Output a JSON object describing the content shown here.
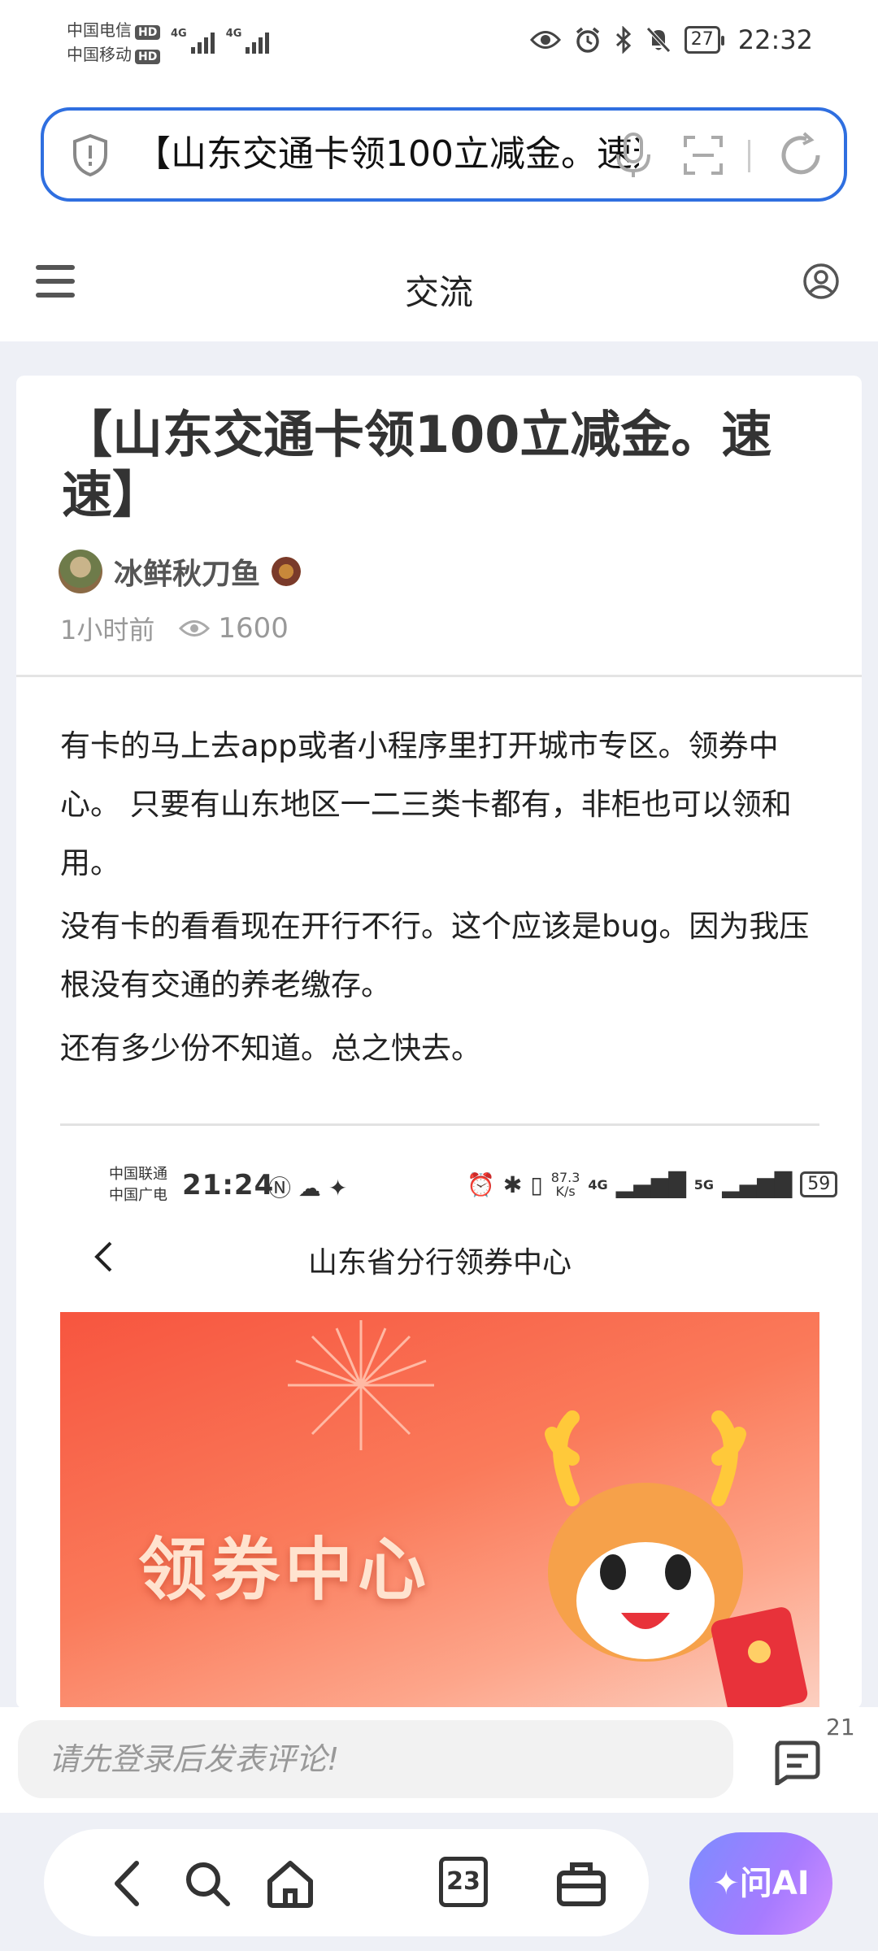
{
  "status_bar": {
    "carrier_1": "中国电信",
    "carrier_2": "中国移动",
    "hd": "HD",
    "network_1": "4G",
    "network_2": "4G",
    "battery": "27",
    "time": "22:32"
  },
  "url_bar": {
    "text": "【山东交通卡领100立减金。速速】"
  },
  "header": {
    "title": "交流"
  },
  "post": {
    "title": "【山东交通卡领100立减金。速速】",
    "author": "冰鲜秋刀鱼",
    "time_ago": "1小时前",
    "views": "1600",
    "paragraphs": [
      "有卡的马上去app或者小程序里打开城市专区。领券中心。 只要有山东地区一二三类卡都有，非柜也可以领和用。",
      "没有卡的看看现在开行不行。这个应该是bug。因为我压根没有交通的养老缴存。",
      "还有多少份不知道。总之快去。"
    ]
  },
  "embedded_screenshot": {
    "carrier_1": "中国联通",
    "carrier_2": "中国广电",
    "time": "21:24",
    "speed_value": "87.3",
    "speed_unit": "K/s",
    "network_1": "4G",
    "network_2": "5G",
    "battery": "59",
    "page_title": "山东省分行领券中心",
    "banner_text": "领券中心"
  },
  "comment_bar": {
    "placeholder": "请先登录后发表评论!",
    "comment_count": "21"
  },
  "bottom_nav": {
    "tab_count": "23",
    "ai_label": "问AI"
  },
  "colors": {
    "accent": "#2f6fe0",
    "banner": "#f7553f"
  }
}
